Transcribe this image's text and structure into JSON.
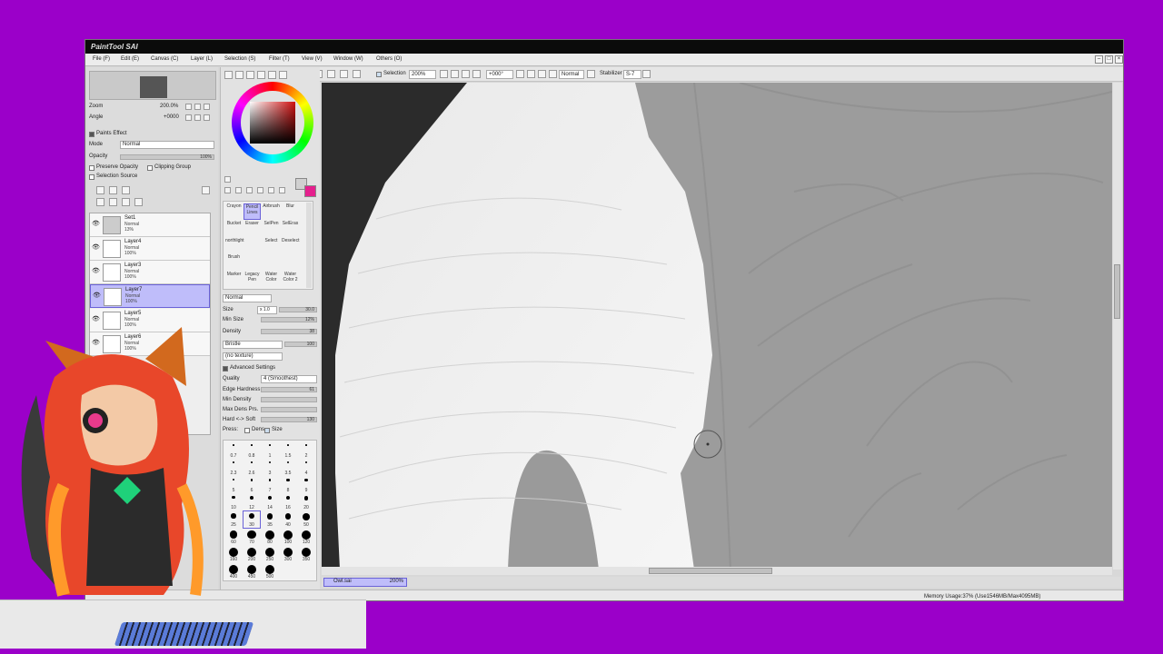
{
  "app": {
    "title": "PaintTool SAI"
  },
  "menu": [
    "File (F)",
    "Edit (E)",
    "Canvas (C)",
    "Layer (L)",
    "Selection (S)",
    "Filter (T)",
    "View (V)",
    "Window (W)",
    "Others (O)"
  ],
  "toolbar": {
    "selection_label": "Selection",
    "zoom_value": "200%",
    "angle_value": "+000°",
    "mode_value": "Normal",
    "stabilizer_label": "Stabilizer",
    "stabilizer_value": "S-7"
  },
  "navigator": {
    "zoom_label": "Zoom",
    "zoom_value": "200.0%",
    "angle_label": "Angle",
    "angle_value": "+0000"
  },
  "layer_props": {
    "paints_effect": "Paints Effect",
    "mode_label": "Mode",
    "mode_value": "Normal",
    "opacity_label": "Opacity",
    "opacity_value": "100%",
    "preserve_opacity": "Preserve Opacity",
    "clipping_group": "Clipping Group",
    "selection_source": "Selection Source"
  },
  "layers": [
    {
      "name": "Set1",
      "mode": "Normal",
      "opacity": "13%"
    },
    {
      "name": "Layer4",
      "mode": "Normal",
      "opacity": "100%"
    },
    {
      "name": "Layer3",
      "mode": "Normal",
      "opacity": "100%"
    },
    {
      "name": "Layer7",
      "mode": "Normal",
      "opacity": "100%"
    },
    {
      "name": "Layer5",
      "mode": "Normal",
      "opacity": "100%"
    },
    {
      "name": "Layer6",
      "mode": "Normal",
      "opacity": "100%"
    }
  ],
  "tools": [
    [
      "Crayon",
      "Pencil Lines",
      "Airbrush",
      "Blur"
    ],
    [
      "Bucket",
      "Eraser",
      "SelPen",
      "SelEras"
    ],
    [
      "northlight",
      "",
      "Select",
      "Deselect"
    ],
    [
      "Brush",
      "",
      "",
      ""
    ],
    [
      "Marker",
      "Legacy Pen",
      "Water Color",
      "Water Color 2"
    ]
  ],
  "brush": {
    "mode_value": "Normal",
    "size_label": "Size",
    "size_mult": "x 1.0",
    "size_value": "30.0",
    "min_size_label": "Min Size",
    "min_size_value": "12%",
    "density_label": "Density",
    "density_value": "38",
    "bristle_label": "Bristle",
    "bristle_value": "100",
    "texture_value": "(no texture)",
    "advanced_label": "Advanced Settings",
    "quality_label": "Quality",
    "quality_value": "4 (Smoothest)",
    "edge_label": "Edge Hardness",
    "edge_value": "61",
    "min_density_label": "Min Density",
    "max_dens_label": "Max Dens Prs.",
    "hard_soft_label": "Hard <-> Soft",
    "hard_soft_value": "130",
    "press_label": "Press:",
    "dens_label": "Dens",
    "size_check_label": "Size"
  },
  "brush_sizes": [
    "0.7",
    "0.8",
    "1",
    "1.5",
    "2",
    "2.3",
    "2.6",
    "3",
    "3.5",
    "4",
    "5",
    "6",
    "7",
    "8",
    "9",
    "10",
    "12",
    "14",
    "16",
    "20",
    "25",
    "30",
    "35",
    "40",
    "50",
    "60",
    "70",
    "80",
    "100",
    "120",
    "160",
    "200",
    "250",
    "300",
    "350",
    "400",
    "450",
    "500"
  ],
  "file_tab": {
    "name": "Owl.sai",
    "zoom": "200%"
  },
  "status": {
    "memory": "Memory Usage:37% (Use1546MB/Max4095MB)"
  },
  "icons": [
    "eye-icon",
    "new-layer-icon",
    "folder-icon",
    "trash-icon",
    "brush-cursor-icon"
  ]
}
